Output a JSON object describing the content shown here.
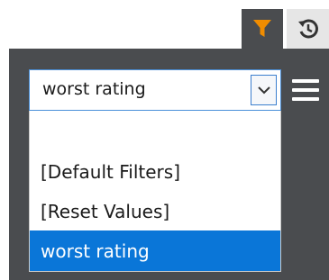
{
  "toolbar": {
    "filter_icon": "funnel-icon",
    "history_icon": "history-icon",
    "filter_color": "#f08c00"
  },
  "select": {
    "value": "worst rating",
    "arrow_icon": "chevron-down-icon"
  },
  "menu_icon": "hamburger-menu-icon",
  "options": [
    {
      "label": ""
    },
    {
      "label": "[Default Filters]"
    },
    {
      "label": "[Reset Values]"
    },
    {
      "label": "worst rating",
      "selected": true
    }
  ],
  "colors": {
    "panel": "#4a4c4f",
    "selected": "#0a76d8",
    "border_focus": "#4a90d9"
  }
}
